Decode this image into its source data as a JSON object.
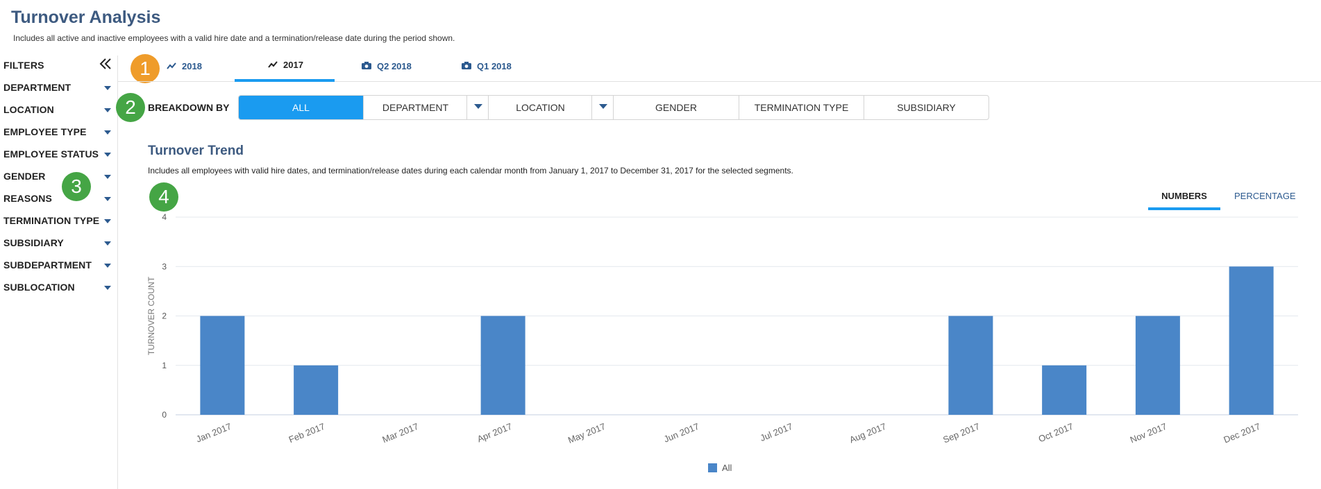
{
  "page": {
    "title": "Turnover Analysis",
    "description": "Includes all active and inactive employees with a valid hire date and a termination/release date during the period shown."
  },
  "filters": {
    "title": "FILTERS",
    "items": [
      {
        "label": "DEPARTMENT"
      },
      {
        "label": "LOCATION"
      },
      {
        "label": "EMPLOYEE TYPE"
      },
      {
        "label": "EMPLOYEE STATUS"
      },
      {
        "label": "GENDER"
      },
      {
        "label": "REASONS"
      },
      {
        "label": "TERMINATION TYPE"
      },
      {
        "label": "SUBSIDIARY"
      },
      {
        "label": "SUBDEPARTMENT"
      },
      {
        "label": "SUBLOCATION"
      }
    ]
  },
  "tabs": [
    {
      "label": "2018",
      "icon": "trend-line-icon",
      "active": false
    },
    {
      "label": "2017",
      "icon": "trend-line-icon",
      "active": true
    },
    {
      "label": "Q2 2018",
      "icon": "camera-icon",
      "active": false
    },
    {
      "label": "Q1 2018",
      "icon": "camera-icon",
      "active": false
    }
  ],
  "badges": [
    "1",
    "2",
    "3",
    "4"
  ],
  "breakdown": {
    "label": "BREAKDOWN BY",
    "options": [
      {
        "label": "ALL",
        "active": true
      },
      {
        "label": "DEPARTMENT",
        "dropdown": true
      },
      {
        "label": "LOCATION",
        "dropdown": true
      },
      {
        "label": "GENDER"
      },
      {
        "label": "TERMINATION TYPE"
      },
      {
        "label": "SUBSIDIARY"
      }
    ]
  },
  "chart_section": {
    "title": "Turnover Trend",
    "description": "Includes all employees with valid hire dates, and termination/release dates during each calendar month from January 1, 2017 to December 31, 2017 for the selected segments.",
    "toggle": {
      "numbers": "NUMBERS",
      "percentage": "PERCENTAGE",
      "selected": "NUMBERS"
    }
  },
  "colors": {
    "title": "#3d5a80",
    "accent": "#1a9bf0",
    "bar": "#4a86c8",
    "link": "#2c5a8f",
    "badge_orange": "#ef9c2a",
    "badge_green": "#45a545"
  },
  "chart_data": {
    "type": "bar",
    "categories": [
      "Jan 2017",
      "Feb 2017",
      "Mar 2017",
      "Apr 2017",
      "May 2017",
      "Jun 2017",
      "Jul 2017",
      "Aug 2017",
      "Sep 2017",
      "Oct 2017",
      "Nov 2017",
      "Dec 2017"
    ],
    "series": [
      {
        "name": "All",
        "values": [
          2,
          1,
          0,
          2,
          0,
          0,
          0,
          0,
          2,
          1,
          2,
          3
        ]
      }
    ],
    "ylabel": "TURNOVER COUNT",
    "xlabel": "",
    "ylim": [
      0,
      4
    ],
    "yticks": [
      0,
      1,
      2,
      3,
      4
    ],
    "grid": true,
    "legend": "bottom-center"
  }
}
